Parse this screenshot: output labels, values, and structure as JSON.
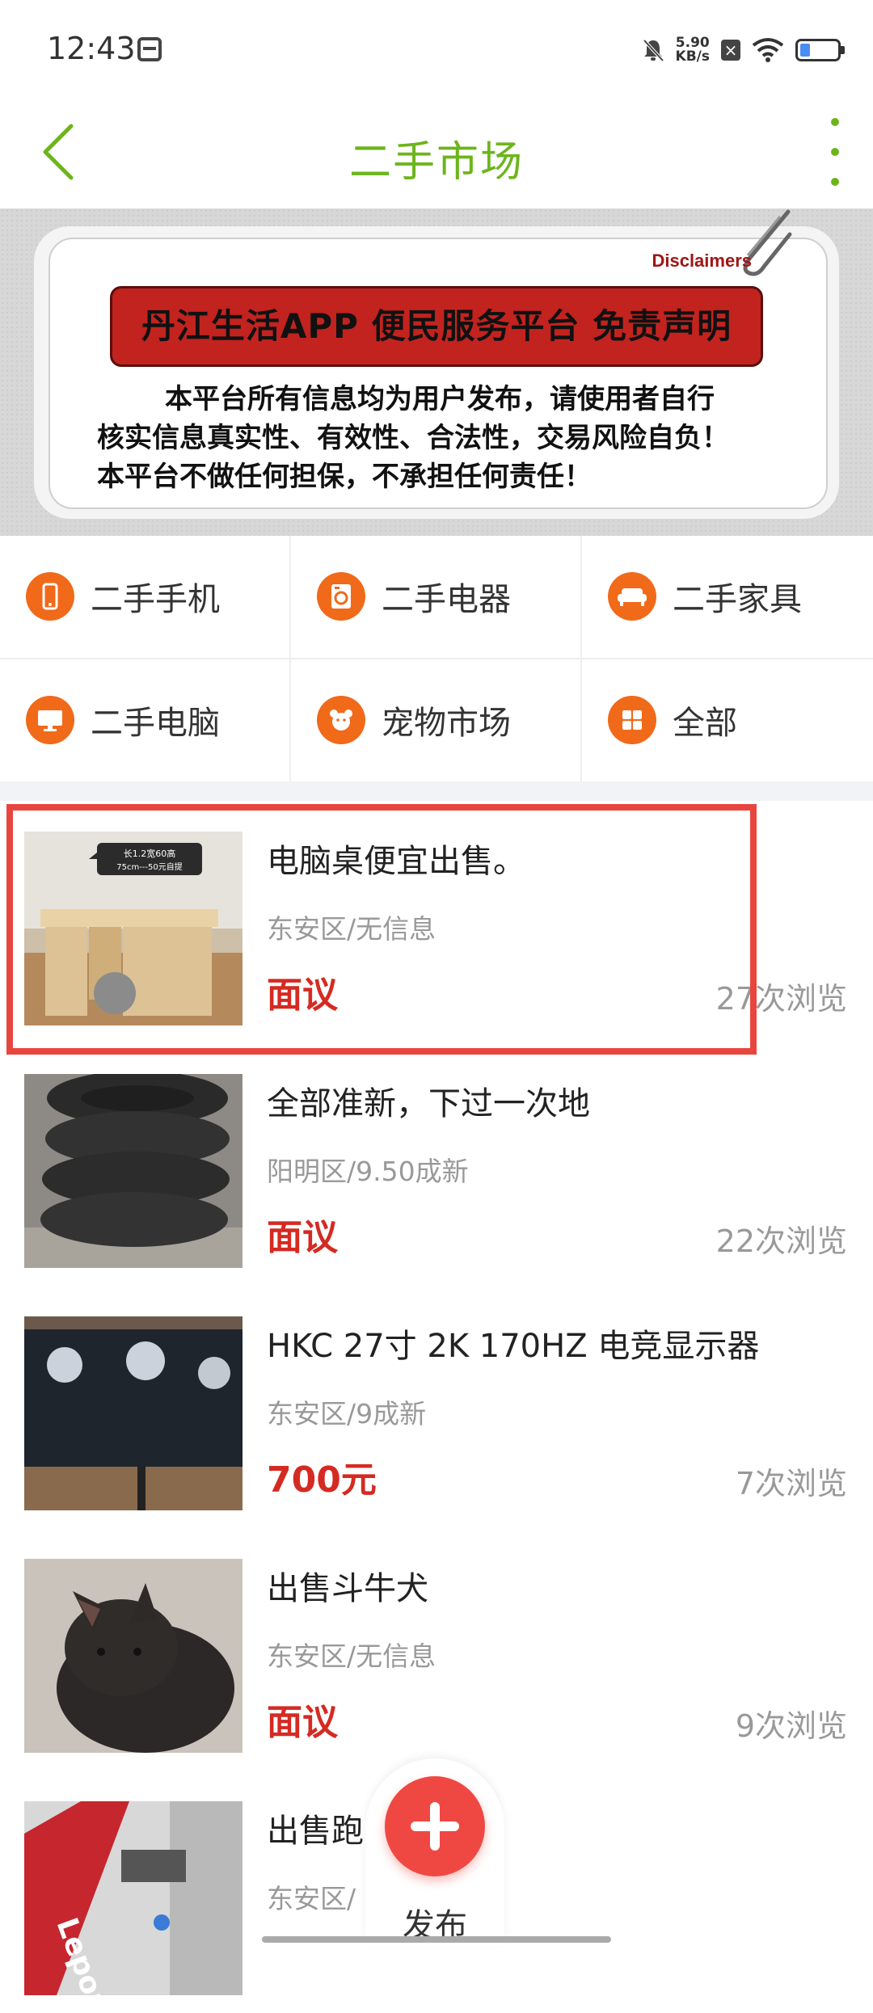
{
  "status_bar": {
    "time": "12:43",
    "net_speed_value": "5.90",
    "net_speed_unit": "KB/s",
    "icons": [
      "calendar-icon",
      "bell-muted-icon",
      "close-box-icon",
      "wifi-icon",
      "battery-icon"
    ]
  },
  "header": {
    "title": "二手市场",
    "accent_color": "#6cb51c"
  },
  "banner": {
    "tag": "Disclaimers",
    "headline": "丹江生活APP 便民服务平台 免责声明",
    "lines": [
      "本平台所有信息均为用户发布，请使用者自行",
      "核实信息真实性、有效性、合法性，交易风险自负！",
      "本平台不做任何担保，不承担任何责任！"
    ]
  },
  "categories": [
    {
      "label": "二手手机",
      "icon": "phone-icon"
    },
    {
      "label": "二手电器",
      "icon": "washer-icon"
    },
    {
      "label": "二手家具",
      "icon": "sofa-icon"
    },
    {
      "label": "二手电脑",
      "icon": "monitor-icon"
    },
    {
      "label": "宠物市场",
      "icon": "pet-icon"
    },
    {
      "label": "全部",
      "icon": "grid-icon"
    }
  ],
  "listings": [
    {
      "title": "电脑桌便宜出售。",
      "subtitle": "东安区/无信息",
      "price": "面议",
      "views": "27次浏览",
      "thumb_caption_1": "长1.2宽60高",
      "thumb_caption_2": "75cm---50元自提"
    },
    {
      "title": "全部准新，下过一次地",
      "subtitle": "阳明区/9.50成新",
      "price": "面议",
      "views": "22次浏览"
    },
    {
      "title": "HKC 27寸 2K 170HZ 电竞显示器",
      "subtitle": "东安区/9成新",
      "price": "700元",
      "views": "7次浏览"
    },
    {
      "title": "出售斗牛犬",
      "subtitle": "东安区/无信息",
      "price": "面议",
      "views": "9次浏览"
    },
    {
      "title": "出售跑",
      "subtitle": "东安区/",
      "price": "",
      "views": "",
      "thumb_text": "Lepou"
    }
  ],
  "publish": {
    "label": "发布",
    "color": "#ef4843"
  },
  "price_color": "#d52a22"
}
